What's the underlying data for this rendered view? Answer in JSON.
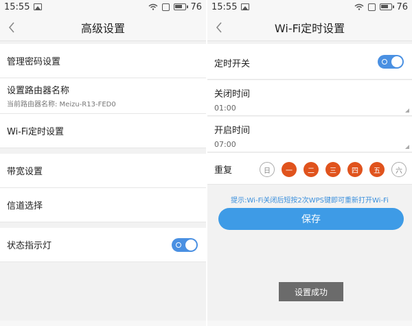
{
  "status_left": {
    "time": "15:55",
    "battery": "76"
  },
  "status_right": {
    "time": "15:55",
    "battery": "76"
  },
  "left_screen": {
    "title": "高级设置",
    "items": [
      {
        "label": "管理密码设置"
      },
      {
        "label": "设置路由器名称",
        "sub": "当前路由器名称:  Meizu-R13-FED0"
      },
      {
        "label": "Wi-Fi定时设置"
      },
      {
        "label": "带宽设置"
      },
      {
        "label": "信道选择"
      },
      {
        "label": "状态指示灯",
        "toggle_on": true
      }
    ]
  },
  "right_screen": {
    "title": "Wi-Fi定时设置",
    "timer_switch": {
      "label": "定时开关",
      "on": true
    },
    "close_time": {
      "label": "关闭时间",
      "value": "01:00"
    },
    "open_time": {
      "label": "开启时间",
      "value": "07:00"
    },
    "repeat": {
      "label": "重复",
      "days": [
        {
          "label": "日",
          "selected": false
        },
        {
          "label": "一",
          "selected": true
        },
        {
          "label": "二",
          "selected": true
        },
        {
          "label": "三",
          "selected": true
        },
        {
          "label": "四",
          "selected": true
        },
        {
          "label": "五",
          "selected": true
        },
        {
          "label": "六",
          "selected": false
        }
      ]
    },
    "hint": "提示:Wi-Fi关闭后短按2次WPS键即可重新打开Wi-Fi",
    "save_label": "保存",
    "toast": "设置成功"
  },
  "colors": {
    "accent": "#3e9be6",
    "day_selected": "#e0531d",
    "hint": "#3a8fdc"
  }
}
